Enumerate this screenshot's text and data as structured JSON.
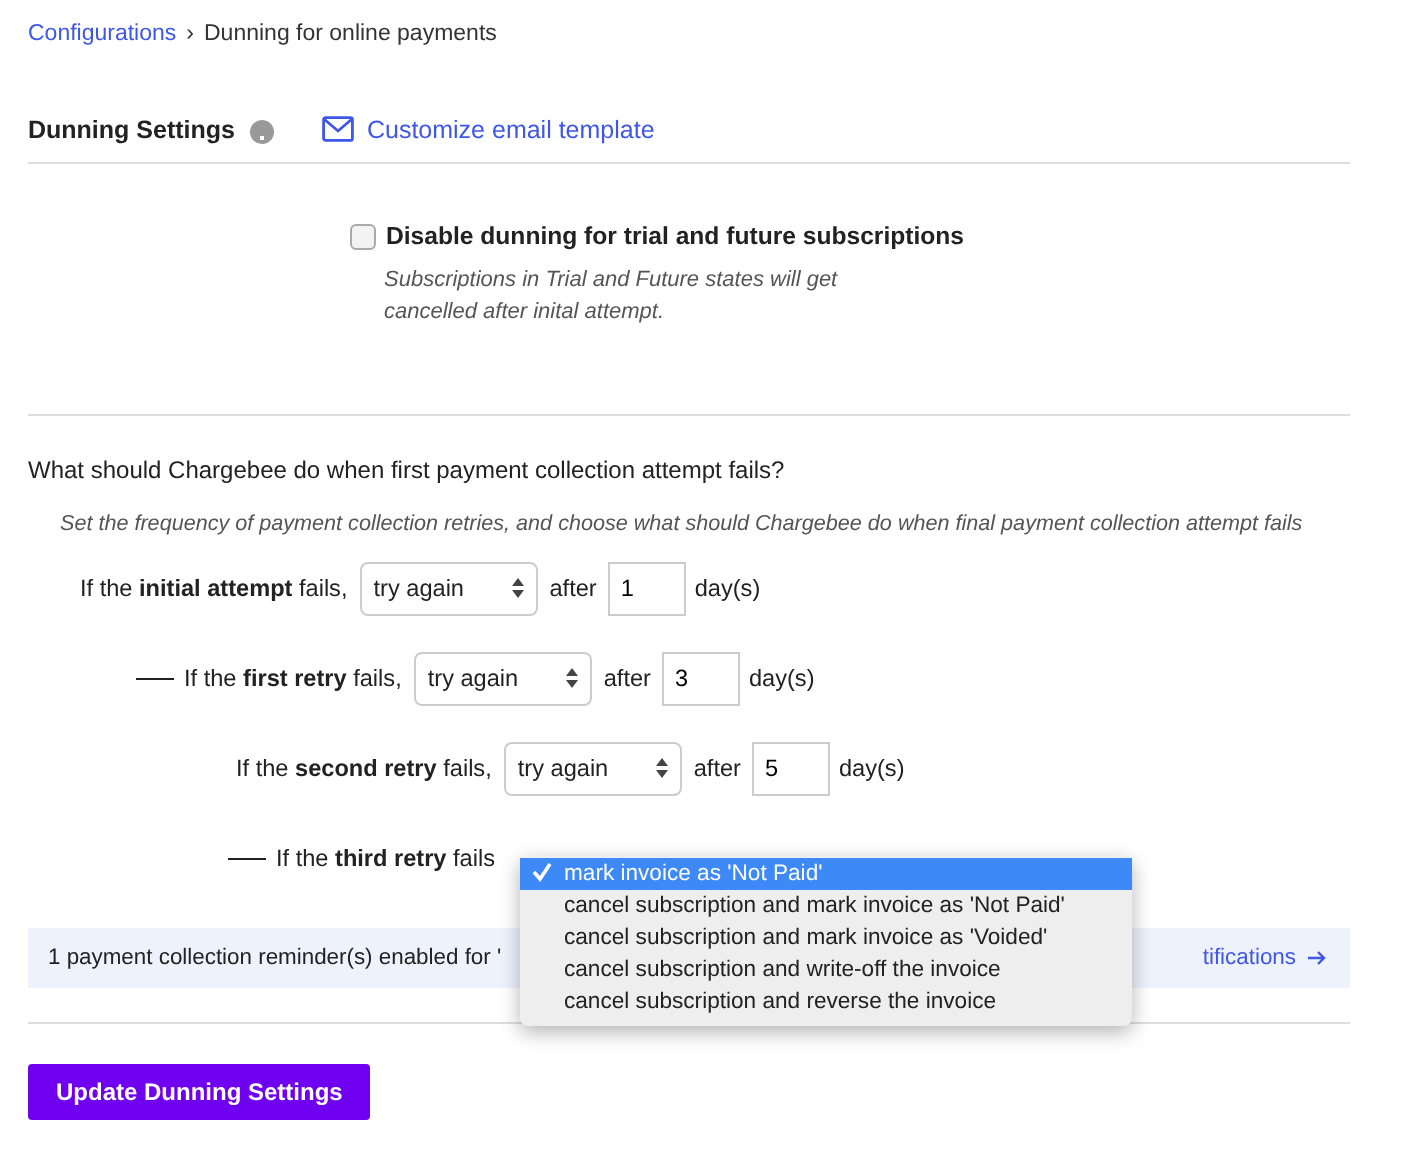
{
  "breadcrumb": {
    "parent": "Configurations",
    "separator": "›",
    "current": "Dunning for online payments"
  },
  "settings_header": {
    "title": "Dunning Settings",
    "email_link": "Customize email template"
  },
  "trial_option": {
    "label": "Disable dunning for trial and future subscriptions",
    "checked": false,
    "note": "Subscriptions in Trial and Future states will get cancelled after inital attempt."
  },
  "question": "What should Chargebee do when first payment collection attempt fails?",
  "hint": "Set the frequency of payment collection retries, and choose what should Chargebee do when final payment collection attempt fails",
  "retries": [
    {
      "kind": "lead",
      "label": "If the **initial attempt** fails,",
      "action": "try again",
      "after": "after",
      "days": "1",
      "unit": "day(s)"
    },
    {
      "kind": "branch",
      "label": "If the **first retry** fails,",
      "action": "try again",
      "after": "after",
      "days": "3",
      "unit": "day(s)"
    },
    {
      "kind": "lead",
      "label": "If the **second retry** fails,",
      "action": "try again",
      "after": "after",
      "days": "5",
      "unit": "day(s)"
    },
    {
      "kind": "branch",
      "label": "If the **third retry** fails",
      "menu": [
        {
          "label": "mark invoice as 'Not Paid'",
          "selected": true
        },
        {
          "label": "cancel subscription and mark invoice as 'Not Paid'",
          "selected": false
        },
        {
          "label": "cancel subscription and mark invoice as 'Voided'",
          "selected": false
        },
        {
          "label": "cancel subscription and write-off the invoice",
          "selected": false
        },
        {
          "label": "cancel subscription and reverse the invoice",
          "selected": false
        }
      ]
    }
  ],
  "reminder_banner": {
    "text": "1 payment collection reminder(s) enabled for '",
    "link": "tifications"
  },
  "submit_button": "Update Dunning Settings"
}
